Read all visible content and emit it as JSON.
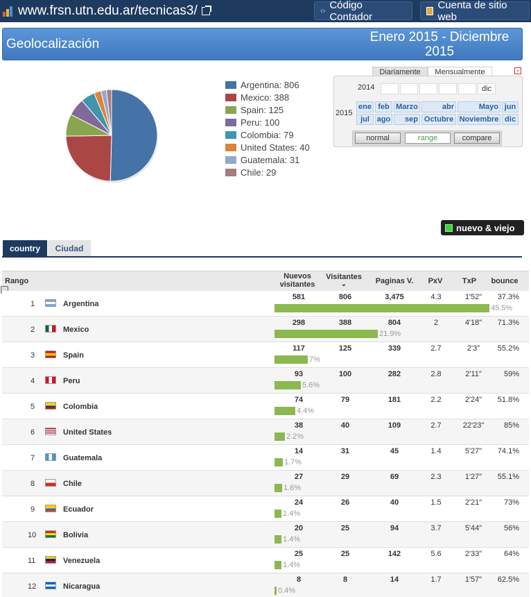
{
  "topbar": {
    "site": "www.frsn.utn.edu.ar/tecnicas3/",
    "btn_counter": "Código Contador",
    "btn_account": "Cuenta de sitio web"
  },
  "header": {
    "title": "Geolocalización",
    "range_line1": "Enero 2015 - Diciembre",
    "range_line2": "2015"
  },
  "chart_data": {
    "type": "pie",
    "categories": [
      "Argentina",
      "Mexico",
      "Spain",
      "Peru",
      "Colombia",
      "United States",
      "Guatemala",
      "Chile"
    ],
    "values": [
      806,
      388,
      125,
      100,
      79,
      40,
      31,
      29
    ],
    "colors": [
      "#4572a7",
      "#aa4643",
      "#89a54e",
      "#80699b",
      "#3d96ae",
      "#db843d",
      "#92a8cd",
      "#a47d7c"
    ],
    "legend": [
      "Argentina: 806",
      "Mexico: 388",
      "Spain: 125",
      "Peru: 100",
      "Colombia: 79",
      "United States: 40",
      "Guatemala: 31",
      "Chile: 29"
    ],
    "legend_placement": "right"
  },
  "calendar": {
    "tab_daily": "Diariamente",
    "tab_monthly": "Mensualmente",
    "year_prev": "2014",
    "year_cur": "2015",
    "dic_prev": "dic",
    "months_row1": [
      "ene",
      "feb",
      "Marzo",
      "abr",
      "Mayo",
      "jun"
    ],
    "months_row2": [
      "jul",
      "ago",
      "sep",
      "Octubre",
      "Noviembre",
      "dic"
    ],
    "btn_normal": "normal",
    "btn_range": "range",
    "btn_compare": "compare"
  },
  "toggle": {
    "label": "nuevo & viejo",
    "active_color": "#3bd43b"
  },
  "tabs": {
    "country": "country",
    "city": "Ciudad"
  },
  "table": {
    "headers": {
      "rank": "Rango",
      "new_l1": "Nuevos",
      "new_l2": "visitantes",
      "visitors": "Visitantes",
      "pages": "Paginas V.",
      "pxv": "PxV",
      "txp": "TxP",
      "bounce": "bounce"
    },
    "rows": [
      {
        "rank": "1",
        "country": "Argentina",
        "flag": "ar",
        "new": "581",
        "visitors": "806",
        "pages": "3,475",
        "pxv": "4.3",
        "txp": "1'52\"",
        "bounce": "37.3%",
        "share": "45.5%",
        "share_value": 45.5
      },
      {
        "rank": "2",
        "country": "Mexico",
        "flag": "mx",
        "new": "298",
        "visitors": "388",
        "pages": "804",
        "pxv": "2",
        "txp": "4'18\"",
        "bounce": "71.3%",
        "share": "21.9%",
        "share_value": 21.9
      },
      {
        "rank": "3",
        "country": "Spain",
        "flag": "es",
        "new": "117",
        "visitors": "125",
        "pages": "339",
        "pxv": "2.7",
        "txp": "2'3\"",
        "bounce": "55.2%",
        "share": "7%",
        "share_value": 7
      },
      {
        "rank": "4",
        "country": "Peru",
        "flag": "pe",
        "new": "93",
        "visitors": "100",
        "pages": "282",
        "pxv": "2.8",
        "txp": "2'11\"",
        "bounce": "59%",
        "share": "5.6%",
        "share_value": 5.6
      },
      {
        "rank": "5",
        "country": "Colombia",
        "flag": "co",
        "new": "74",
        "visitors": "79",
        "pages": "181",
        "pxv": "2.2",
        "txp": "2'24\"",
        "bounce": "51.8%",
        "share": "4.4%",
        "share_value": 4.4
      },
      {
        "rank": "6",
        "country": "United States",
        "flag": "us",
        "new": "38",
        "visitors": "40",
        "pages": "109",
        "pxv": "2.7",
        "txp": "22'23\"",
        "bounce": "85%",
        "share": "2.2%",
        "share_value": 2.2
      },
      {
        "rank": "7",
        "country": "Guatemala",
        "flag": "gt",
        "new": "14",
        "visitors": "31",
        "pages": "45",
        "pxv": "1.4",
        "txp": "5'27\"",
        "bounce": "74.1%",
        "share": "1.7%",
        "share_value": 1.7
      },
      {
        "rank": "8",
        "country": "Chile",
        "flag": "cl",
        "new": "27",
        "visitors": "29",
        "pages": "69",
        "pxv": "2.3",
        "txp": "1'27\"",
        "bounce": "55.1%",
        "share": "1.6%",
        "share_value": 1.6
      },
      {
        "rank": "9",
        "country": "Ecuador",
        "flag": "ec",
        "new": "24",
        "visitors": "26",
        "pages": "40",
        "pxv": "1.5",
        "txp": "2'21\"",
        "bounce": "73%",
        "share": "1.4%",
        "share_value": 1.4
      },
      {
        "rank": "10",
        "country": "Bolivia",
        "flag": "bo",
        "new": "20",
        "visitors": "25",
        "pages": "94",
        "pxv": "3.7",
        "txp": "5'44\"",
        "bounce": "56%",
        "share": "1.4%",
        "share_value": 1.4
      },
      {
        "rank": "11",
        "country": "Venezuela",
        "flag": "ve",
        "new": "25",
        "visitors": "25",
        "pages": "142",
        "pxv": "5.6",
        "txp": "2'33\"",
        "bounce": "64%",
        "share": "1.4%",
        "share_value": 1.4
      },
      {
        "rank": "12",
        "country": "Nicaragua",
        "flag": "ni",
        "new": "8",
        "visitors": "8",
        "pages": "14",
        "pxv": "1.7",
        "txp": "1'57\"",
        "bounce": "62.5%",
        "share": "0.4%",
        "share_value": 0.4
      }
    ]
  }
}
